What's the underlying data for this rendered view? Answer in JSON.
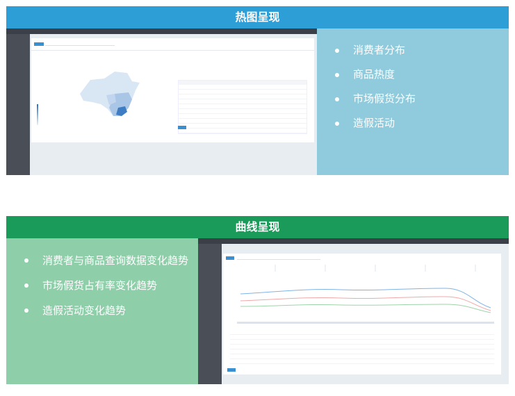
{
  "heatmap": {
    "title": "热图呈现",
    "bullets": [
      "消费者分布",
      "商品热度",
      "市场假货分布",
      "造假活动"
    ]
  },
  "curve": {
    "title": "曲线呈现",
    "bullets": [
      "消费者与商品查询数据变化趋势",
      "市场假货占有率变化趋势",
      "造假活动变化趋势"
    ]
  },
  "colors": {
    "heatmap_header": "#2e9ed6",
    "heatmap_panel": "#8fcbdc",
    "curve_header": "#1a9b5a",
    "curve_panel": "#8ecfaa"
  }
}
